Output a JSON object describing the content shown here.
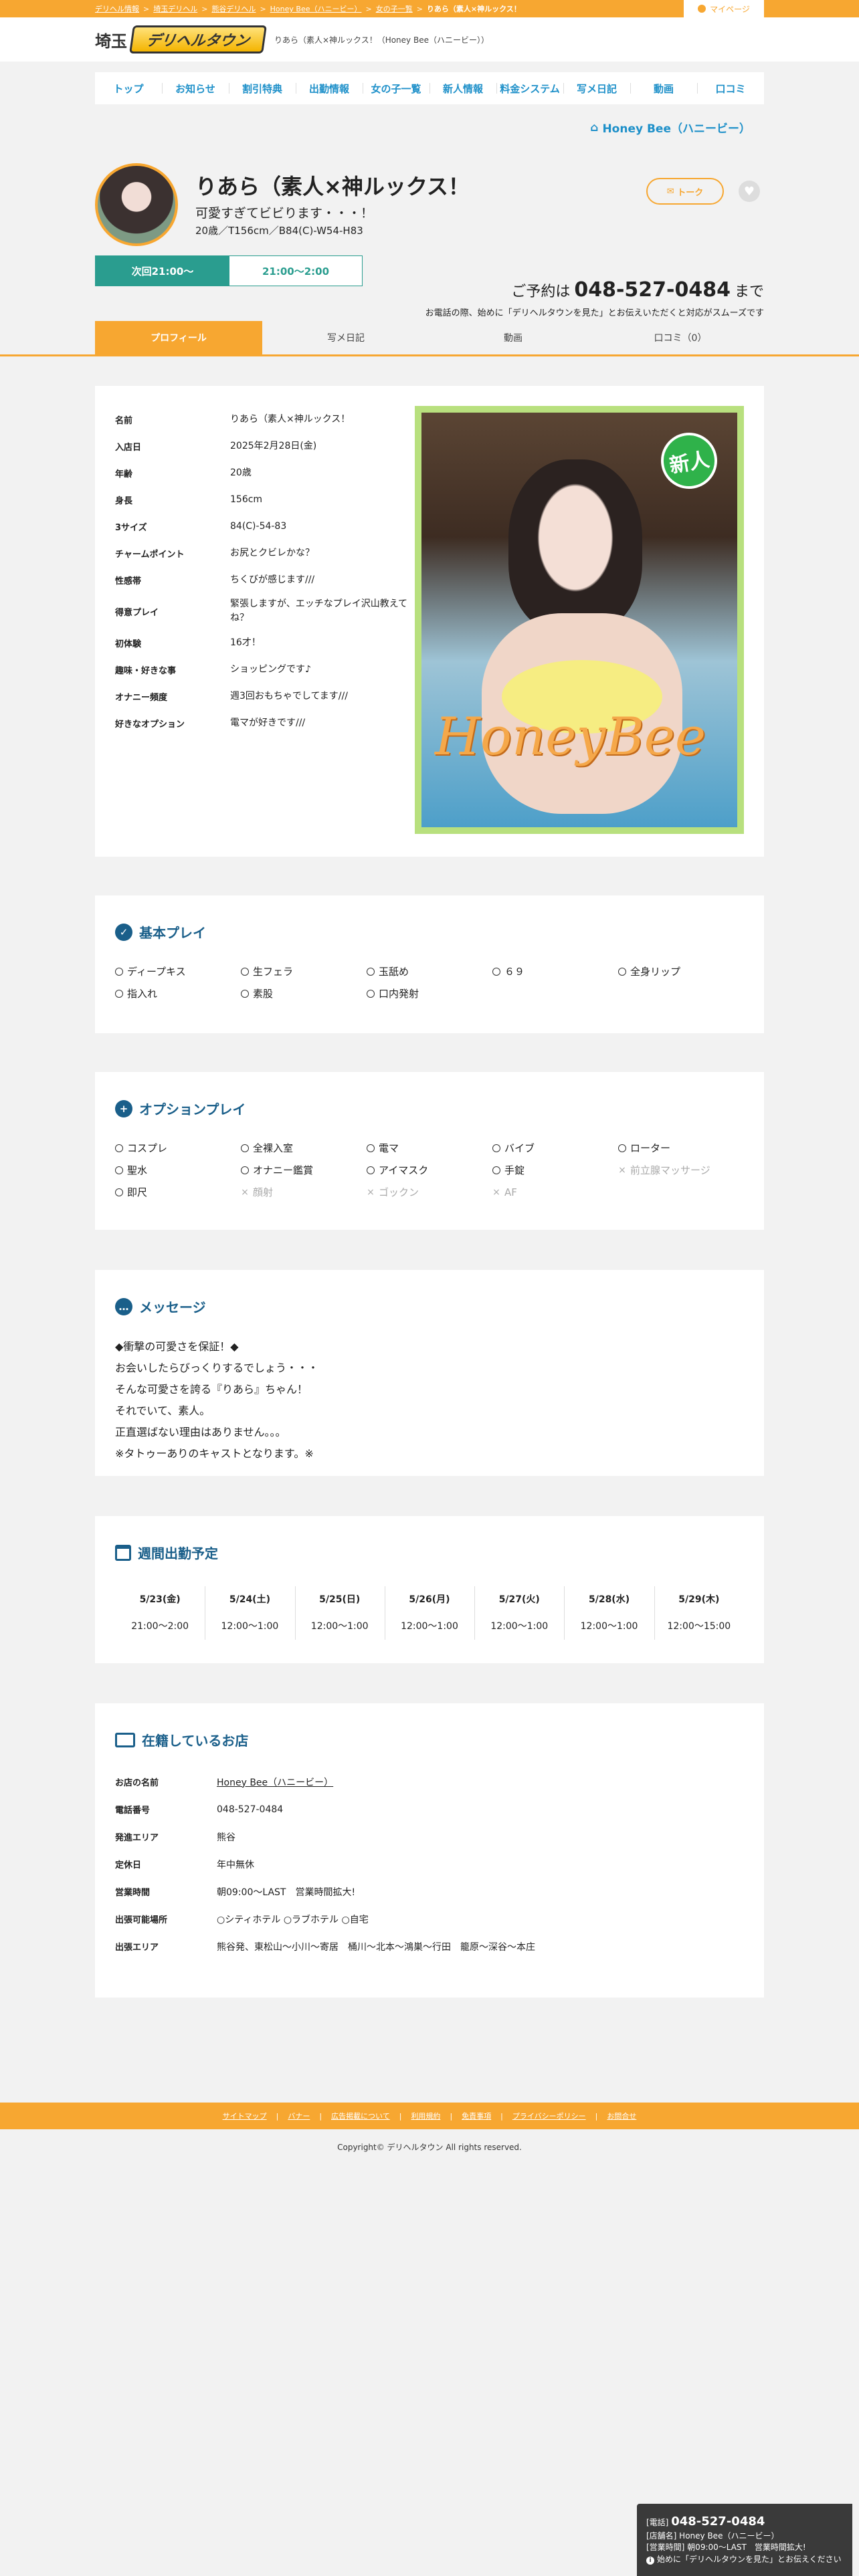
{
  "topbar": {
    "breadcrumb": [
      "デリヘル情報",
      "埼玉デリヘル",
      "熊谷デリヘル",
      "Honey Bee（ハニービー）",
      "女の子一覧"
    ],
    "current": "りあら（素人×神ルックス！",
    "mypage": "マイページ"
  },
  "header": {
    "pref": "埼玉",
    "logo_text": "デリヘルタウン",
    "desc": "りあら（素人×神ルックス！（Honey Bee（ハニービー））"
  },
  "nav": [
    "トップ",
    "お知らせ",
    "割引特典",
    "出勤情報",
    "女の子一覧",
    "新人情報",
    "料金システム",
    "写メ日記",
    "動画",
    "口コミ"
  ],
  "profile": {
    "shop_link": "Honey Bee（ハニービー）",
    "name": "りあら（素人×神ルックス！",
    "catch": "可愛すぎてビビります・・・！",
    "spec": "20歳／T156cm／B84(C)-W54-H83",
    "talk": "トーク",
    "next_label": "次回21:00〜",
    "next_value": "21:00〜2:00"
  },
  "reserve": {
    "prefix": "ご予約は",
    "tel": "048-527-0484",
    "suffix": "まで",
    "note": "お電話の際、始めに「デリヘルタウンを見た」とお伝えいただくと対応がスムーズです"
  },
  "tabs": [
    "プロフィール",
    "写メ日記",
    "動画",
    "口コミ（0）"
  ],
  "prof_rows": [
    {
      "k": "名前",
      "v": "りあら（素人×神ルックス！"
    },
    {
      "k": "入店日",
      "v": "2025年2月28日(金)"
    },
    {
      "k": "年齢",
      "v": "20歳"
    },
    {
      "k": "身長",
      "v": "156cm"
    },
    {
      "k": "3サイズ",
      "v": "84(C)-54-83"
    },
    {
      "k": "チャームポイント",
      "v": "お尻とクビレかな？"
    },
    {
      "k": "性感帯",
      "v": "ちくびが感じます///"
    },
    {
      "k": "得意プレイ",
      "v": "緊張しますが、エッチなプレイ沢山教えてね？"
    },
    {
      "k": "初体験",
      "v": "16才！"
    },
    {
      "k": "趣味・好きな事",
      "v": "ショッピングです♪"
    },
    {
      "k": "オナニー頻度",
      "v": "週3回おもちゃでしてます///"
    },
    {
      "k": "好きなオプション",
      "v": "電マが好きです///"
    }
  ],
  "photo": {
    "new_badge": "新人",
    "watermark": "HoneyBee"
  },
  "basic": {
    "title": "基本プレイ",
    "items": [
      {
        "label": "ディープキス",
        "ok": true
      },
      {
        "label": "生フェラ",
        "ok": true
      },
      {
        "label": "玉舐め",
        "ok": true
      },
      {
        "label": "６９",
        "ok": true
      },
      {
        "label": "全身リップ",
        "ok": true
      },
      {
        "label": "指入れ",
        "ok": true
      },
      {
        "label": "素股",
        "ok": true
      },
      {
        "label": "口内発射",
        "ok": true
      }
    ]
  },
  "option": {
    "title": "オプションプレイ",
    "items": [
      {
        "label": "コスプレ",
        "ok": true
      },
      {
        "label": "全裸入室",
        "ok": true
      },
      {
        "label": "電マ",
        "ok": true
      },
      {
        "label": "バイブ",
        "ok": true
      },
      {
        "label": "ローター",
        "ok": true
      },
      {
        "label": "聖水",
        "ok": true
      },
      {
        "label": "オナニー鑑賞",
        "ok": true
      },
      {
        "label": "アイマスク",
        "ok": true
      },
      {
        "label": "手錠",
        "ok": true
      },
      {
        "label": "前立腺マッサージ",
        "ok": false
      },
      {
        "label": "即尺",
        "ok": true
      },
      {
        "label": "顔射",
        "ok": false
      },
      {
        "label": "ゴックン",
        "ok": false
      },
      {
        "label": "AF",
        "ok": false
      }
    ]
  },
  "message": {
    "title": "メッセージ",
    "lines": [
      "◆衝撃の可愛さを保証！◆",
      "お会いしたらびっくりするでしょう・・・",
      "そんな可愛さを誇る『りあら』ちゃん！",
      "それでいて、素人。",
      "正直選ばない理由はありません。。。",
      "※タトゥーありのキャストとなります。※"
    ]
  },
  "weekly": {
    "title": "週間出勤予定",
    "days": [
      {
        "d": "5/23(金)",
        "t": "21:00〜2:00"
      },
      {
        "d": "5/24(土)",
        "t": "12:00〜1:00"
      },
      {
        "d": "5/25(日)",
        "t": "12:00〜1:00"
      },
      {
        "d": "5/26(月)",
        "t": "12:00〜1:00"
      },
      {
        "d": "5/27(火)",
        "t": "12:00〜1:00"
      },
      {
        "d": "5/28(水)",
        "t": "12:00〜1:00"
      },
      {
        "d": "5/29(木)",
        "t": "12:00〜15:00"
      }
    ]
  },
  "shop": {
    "title": "在籍しているお店",
    "rows": [
      {
        "k": "お店の名前",
        "v": "Honey Bee（ハニービー）"
      },
      {
        "k": "電話番号",
        "v": "048-527-0484"
      },
      {
        "k": "発進エリア",
        "v": "熊谷"
      },
      {
        "k": "定休日",
        "v": "年中無休"
      },
      {
        "k": "営業時間",
        "v": "朝09:00〜LAST　営業時間拡大!"
      },
      {
        "k": "出張可能場所",
        "v": "○シティホテル ○ラブホテル ○自宅"
      },
      {
        "k": "出張エリア",
        "v": "熊谷発、東松山〜小川〜寄居　桶川〜北本〜鴻巣〜行田　籠原〜深谷〜本庄"
      }
    ]
  },
  "footer": {
    "links": [
      "サイトマップ",
      "バナー",
      "広告掲載について",
      "利用規約",
      "免責事項",
      "プライバシーポリシー",
      "お問合せ"
    ],
    "copyright": "Copyright© デリヘルタウン All rights reserved."
  },
  "float": {
    "tel_label": "[電話]",
    "tel": "048-527-0484",
    "shop": "[店舗名] Honey Bee（ハニービー）",
    "hours": "[営業時間] 朝09:00〜LAST　営業時間拡大!",
    "note": "始めに「デリヘルタウンを見た」とお伝えください"
  },
  "colors": {
    "accent": "#f7a731",
    "link": "#1e90c9",
    "heading": "#1a5f8a",
    "green": "#2a9d8f"
  }
}
